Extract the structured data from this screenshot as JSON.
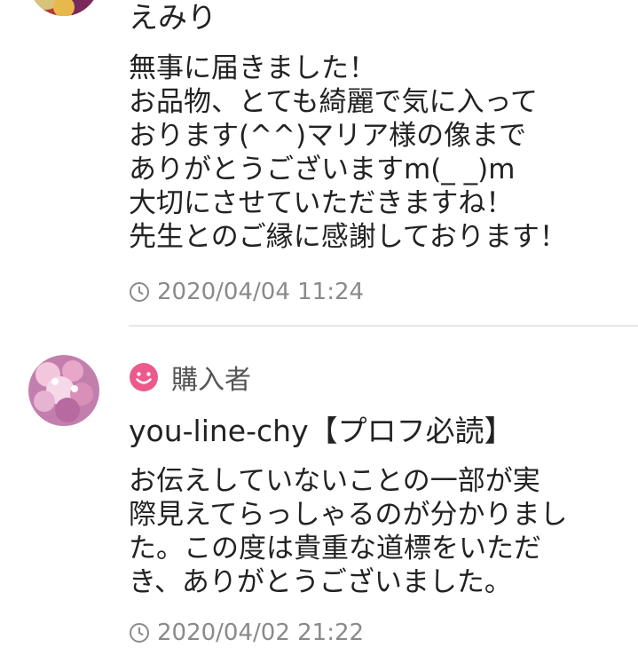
{
  "reviews": [
    {
      "username": "えみり",
      "message": "無事に届きました！\nお品物、とても綺麗で気に入って\nおります(^^)マリア様の像まで\nありがとうございますm(_ _)m\n大切にさせていただきますね！\n先生とのご縁に感謝しております！",
      "timestamp": "2020/04/04 11:24"
    },
    {
      "role_badge": "購入者",
      "username": "you-line-chy【プロフ必読】",
      "message": "お伝えしていないことの一部が実\n際見えてらっしゃるのが分かりまし\nた。この度は貴重な道標をいただ\nき、ありがとうございました。",
      "timestamp": "2020/04/02 21:22"
    }
  ],
  "icons": {
    "timestamp": "clock-icon",
    "buyer_badge": "smile-icon"
  },
  "colors": {
    "buyer_badge_icon": "#ec5a8c",
    "timestamp_text": "#8a8a8a",
    "divider": "#e6e6e6"
  }
}
